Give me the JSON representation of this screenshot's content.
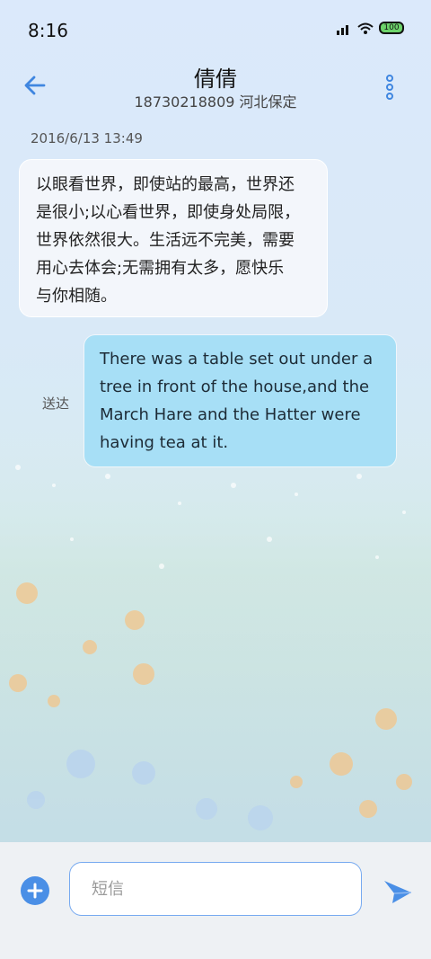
{
  "status": {
    "time": "8:16",
    "battery": "100"
  },
  "header": {
    "contact_name": "倩倩",
    "contact_info": "18730218809 河北保定"
  },
  "conversation": {
    "timestamp": "2016/6/13 13:49",
    "incoming": {
      "lines": [
        "以眼看世界，即使站的最高，世界还",
        "是很小;以心看世界，即使身处局限，",
        "世界依然很大。生活远不完美，需要",
        "用心去体会;无需拥有太多，愿快乐",
        "与你相随。"
      ]
    },
    "outgoing": {
      "status": "送达",
      "lines": [
        "There was a table set out under a",
        "tree in front of the house,and the",
        "March Hare and the Hatter were",
        "having tea at it."
      ]
    }
  },
  "composer": {
    "placeholder": "短信",
    "value": ""
  },
  "colors": {
    "accent": "#4a8fe6",
    "outgoing_bubble": "#a7dff6"
  },
  "icons": {
    "back": "arrow-left-icon",
    "more": "more-vertical-icon",
    "add": "plus-circle-icon",
    "send": "send-icon"
  }
}
